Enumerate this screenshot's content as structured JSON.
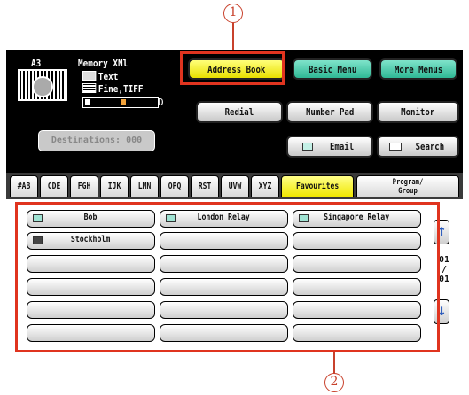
{
  "callouts": {
    "one": "1",
    "two": "2"
  },
  "status": {
    "paper_size": "A3",
    "memory": "Memory XNl",
    "original_type": "Text",
    "resolution": "Fine,TIFF",
    "destinations": "Destinations: 000"
  },
  "menus": {
    "address_book": "Address Book",
    "basic_menu": "Basic Menu",
    "more_menus": "More Menus"
  },
  "actions": {
    "redial": "Redial",
    "number_pad": "Number Pad",
    "monitor": "Monitor",
    "email": "Email",
    "search": "Search"
  },
  "tabs": [
    "#AB",
    "CDE",
    "FGH",
    "IJK",
    "LMN",
    "OPQ",
    "RST",
    "UVW",
    "XYZ",
    "Favourites",
    "Program/ Group"
  ],
  "active_tab": "Favourites",
  "entries": [
    {
      "name": "Bob",
      "icon": "email-icon"
    },
    {
      "name": "London Relay",
      "icon": "email-icon"
    },
    {
      "name": "Singapore Relay",
      "icon": "email-icon"
    },
    {
      "name": "Stockholm",
      "icon": "fax-icon"
    }
  ],
  "pager": {
    "current": "01",
    "sep": "/",
    "total": "01"
  },
  "colors": {
    "address_book_bg": "#f0e800",
    "menu_bg": "#2fb895",
    "callout_red": "#e0341f",
    "screen_bg": "#000000"
  }
}
